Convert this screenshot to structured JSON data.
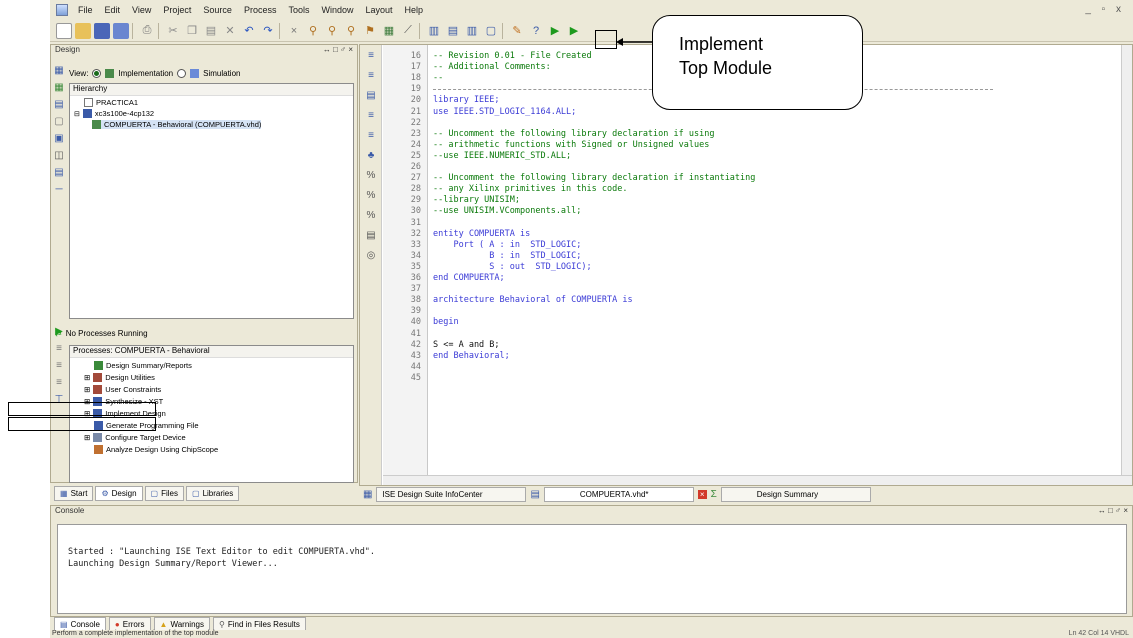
{
  "menu": [
    "File",
    "Edit",
    "View",
    "Project",
    "Source",
    "Process",
    "Tools",
    "Window",
    "Layout",
    "Help"
  ],
  "window_controls": "_ ▫ x",
  "design_panel": {
    "title": "Design",
    "panel_controls": "↔ □ ♂ ×",
    "view_label": "View:",
    "view_impl": "Implementation",
    "view_sim": "Simulation",
    "hierarchy_label": "Hierarchy",
    "tree": [
      "PRACTICA1",
      "xc3s100e-4cp132",
      "COMPUERTA - Behavioral (COMPUERTA.vhd)"
    ]
  },
  "processes": {
    "running": "No Processes Running",
    "header": "Processes: COMPUERTA - Behavioral",
    "items": [
      "Design Summary/Reports",
      "Design Utilities",
      "User Constraints",
      "Synthesize - XST",
      "Implement Design",
      "Generate Programming File",
      "Configure Target Device",
      "Analyze Design Using ChipScope"
    ]
  },
  "left_tabs": [
    "Start",
    "Design",
    "Files",
    "Libraries"
  ],
  "editor": {
    "lines": [
      {
        "n": "16",
        "t": "-- Revision 0.01 - File Created",
        "cls": "cmt"
      },
      {
        "n": "17",
        "t": "-- Additional Comments:",
        "cls": "cmt"
      },
      {
        "n": "18",
        "t": "--",
        "cls": "cmt"
      },
      {
        "n": "19",
        "t": "",
        "cls": ""
      },
      {
        "n": "20",
        "t": "library IEEE;",
        "cls": "kw"
      },
      {
        "n": "21",
        "t": "use IEEE.STD_LOGIC_1164.ALL;",
        "cls": "kw"
      },
      {
        "n": "22",
        "t": "",
        "cls": ""
      },
      {
        "n": "23",
        "t": "-- Uncomment the following library declaration if using",
        "cls": "cmt"
      },
      {
        "n": "24",
        "t": "-- arithmetic functions with Signed or Unsigned values",
        "cls": "cmt"
      },
      {
        "n": "25",
        "t": "--use IEEE.NUMERIC_STD.ALL;",
        "cls": "cmt"
      },
      {
        "n": "26",
        "t": "",
        "cls": ""
      },
      {
        "n": "27",
        "t": "-- Uncomment the following library declaration if instantiating",
        "cls": "cmt"
      },
      {
        "n": "28",
        "t": "-- any Xilinx primitives in this code.",
        "cls": "cmt"
      },
      {
        "n": "29",
        "t": "--library UNISIM;",
        "cls": "cmt"
      },
      {
        "n": "30",
        "t": "--use UNISIM.VComponents.all;",
        "cls": "cmt"
      },
      {
        "n": "31",
        "t": "",
        "cls": ""
      },
      {
        "n": "32",
        "t": "entity COMPUERTA is",
        "cls": "kw"
      },
      {
        "n": "33",
        "t": "    Port ( A : in  STD_LOGIC;",
        "cls": "kw"
      },
      {
        "n": "34",
        "t": "           B : in  STD_LOGIC;",
        "cls": "kw"
      },
      {
        "n": "35",
        "t": "           S : out  STD_LOGIC);",
        "cls": "kw"
      },
      {
        "n": "36",
        "t": "end COMPUERTA;",
        "cls": "kw"
      },
      {
        "n": "37",
        "t": "",
        "cls": ""
      },
      {
        "n": "38",
        "t": "architecture Behavioral of COMPUERTA is",
        "cls": "kw"
      },
      {
        "n": "39",
        "t": "",
        "cls": ""
      },
      {
        "n": "40",
        "t": "begin",
        "cls": "kw"
      },
      {
        "n": "41",
        "t": "",
        "cls": ""
      },
      {
        "n": "42",
        "t": "S <= A and B;",
        "cls": ""
      },
      {
        "n": "43",
        "t": "end Behavioral;",
        "cls": "kw"
      },
      {
        "n": "44",
        "t": "",
        "cls": ""
      },
      {
        "n": "45",
        "t": "",
        "cls": ""
      }
    ]
  },
  "editor_tabs": [
    "ISE Design Suite InfoCenter",
    "COMPUERTA.vhd*",
    "Design Summary"
  ],
  "console": {
    "title": "Console",
    "lines": [
      "Started : \"Launching ISE Text Editor to edit COMPUERTA.vhd\".",
      "Launching Design Summary/Report Viewer..."
    ]
  },
  "console_tabs": [
    "Console",
    "Errors",
    "Warnings",
    "Find in Files Results"
  ],
  "status": {
    "message": "Perform a complete implementation of the top module",
    "position": "Ln 42 Col 14  VHDL"
  },
  "callout": {
    "line1": "Implement",
    "line2": "Top Module"
  },
  "tooltip_fragment": "Implement"
}
